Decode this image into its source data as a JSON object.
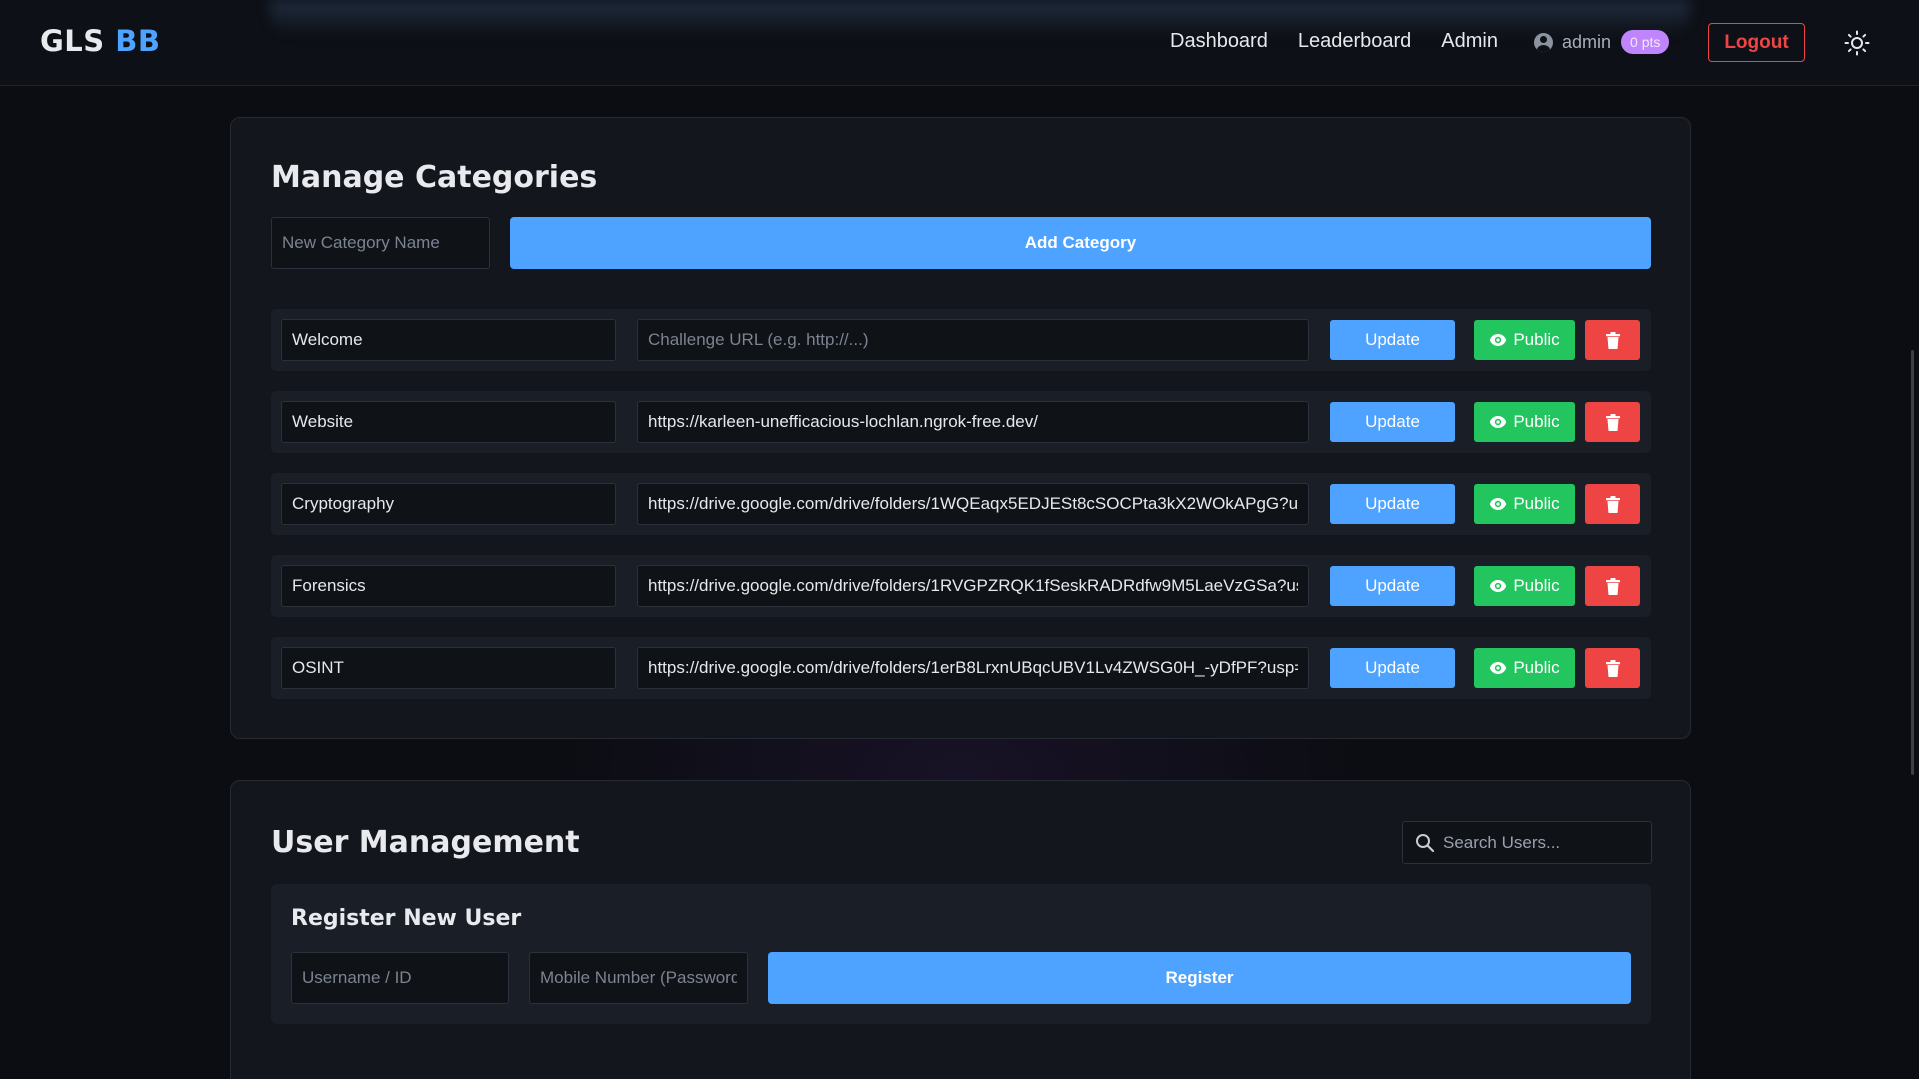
{
  "header": {
    "brand_main": "GLS",
    "brand_accent": "BB",
    "nav": [
      "Dashboard",
      "Leaderboard",
      "Admin"
    ],
    "username": "admin",
    "points": "0 pts",
    "logout_label": "Logout",
    "theme_icon": "sun-icon"
  },
  "categories": {
    "title": "Manage Categories",
    "new_placeholder": "New Category Name",
    "add_label": "Add Category",
    "url_placeholder": "Challenge URL (e.g. http://...)",
    "update_label": "Update",
    "public_label": "Public",
    "rows": [
      {
        "name": "Welcome",
        "url": ""
      },
      {
        "name": "Website",
        "url": "https://karleen-unefficacious-lochlan.ngrok-free.dev/"
      },
      {
        "name": "Cryptography",
        "url": "https://drive.google.com/drive/folders/1WQEaqx5EDJESt8cSOCPta3kX2WOkAPgG?usp=s"
      },
      {
        "name": "Forensics",
        "url": "https://drive.google.com/drive/folders/1RVGPZRQK1fSeskRADRdfw9M5LaeVzGSa?usp=s"
      },
      {
        "name": "OSINT",
        "url": "https://drive.google.com/drive/folders/1erB8LrxnUBqcUBV1Lv4ZWSG0H_-yDfPF?usp=sh"
      }
    ]
  },
  "users": {
    "title": "User Management",
    "search_placeholder": "Search Users...",
    "register_title": "Register New User",
    "username_placeholder": "Username / ID",
    "password_placeholder": "Mobile Number (Password)",
    "register_label": "Register"
  },
  "colors": {
    "accent": "#4da3ff",
    "success": "#22c55e",
    "danger": "#ef4444",
    "badge": "#c084fc"
  }
}
